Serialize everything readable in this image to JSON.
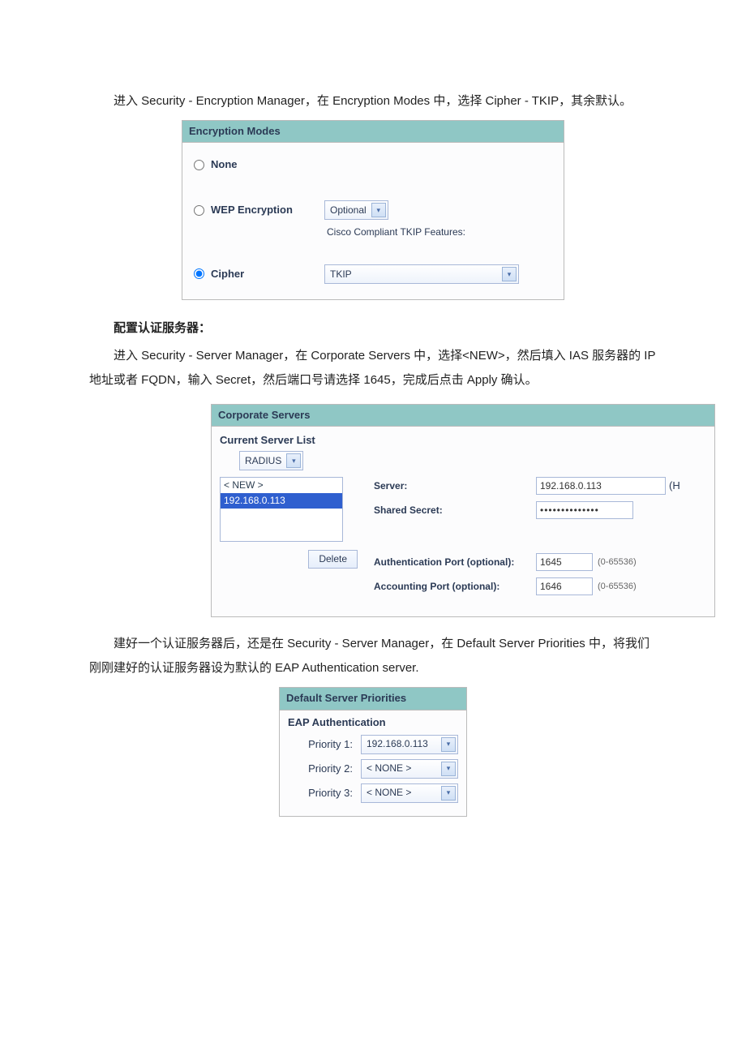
{
  "text": {
    "p1a": "进入 Security - Encryption Manager，在 Encryption Modes 中，选择 Cipher - TKIP，其余默认。",
    "h2": "配置认证服务器：",
    "p2": "进入 Security - Server Manager，在 Corporate Servers 中，选择<NEW>，然后填入 IAS 服务器的 IP 地址或者 FQDN，输入 Secret，然后端口号请选择 1645，完成后点击 Apply 确认。",
    "p3": "建好一个认证服务器后，还是在 Security - Server Manager，在 Default Server Priorities 中，将我们刚刚建好的认证服务器设为默认的 EAP Authentication server."
  },
  "encryption": {
    "title": "Encryption Modes",
    "opt_none": "None",
    "opt_wep": "WEP Encryption",
    "wep_sel": "Optional",
    "tkip_note": "Cisco Compliant TKIP Features:",
    "opt_cipher": "Cipher",
    "cipher_sel": "TKIP"
  },
  "corp": {
    "title": "Corporate Servers",
    "list_head": "Current Server List",
    "list_type": "RADIUS",
    "list_items": [
      "< NEW >",
      "192.168.0.113"
    ],
    "delete": "Delete",
    "server_label": "Server:",
    "server_value": "192.168.0.113",
    "server_suffix": "(H",
    "secret_label": "Shared Secret:",
    "secret_value": "••••••••••••••",
    "auth_label": "Authentication Port (optional):",
    "auth_value": "1645",
    "acct_label": "Accounting Port (optional):",
    "acct_value": "1646",
    "port_hint": "(0-65536)"
  },
  "prio": {
    "title": "Default Server Priorities",
    "sub": "EAP Authentication",
    "rows": [
      {
        "label": "Priority 1:",
        "value": "192.168.0.113"
      },
      {
        "label": "Priority 2:",
        "value": "< NONE >"
      },
      {
        "label": "Priority 3:",
        "value": "< NONE >"
      }
    ]
  }
}
